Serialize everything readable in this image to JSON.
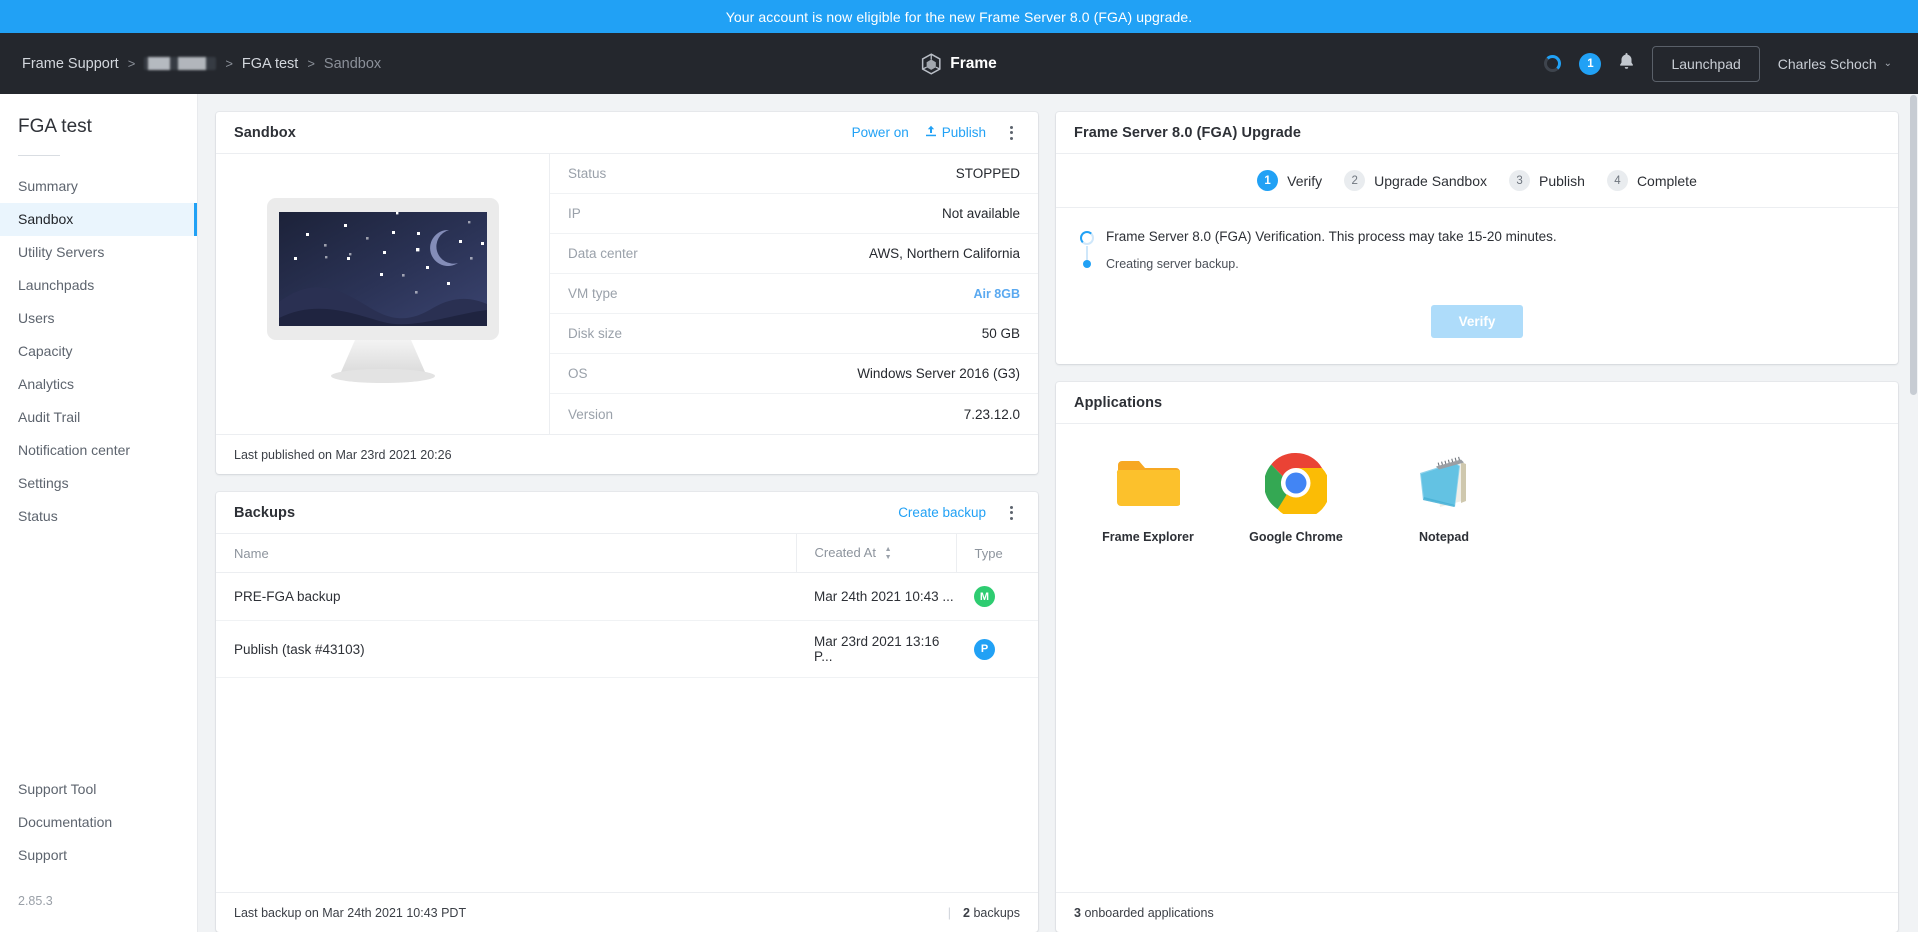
{
  "banner": {
    "message": "Your account is now eligible for the new Frame Server 8.0 (FGA) upgrade."
  },
  "header": {
    "brand": "Frame",
    "breadcrumb": [
      {
        "label": "Frame Support",
        "redacted": false,
        "current": false
      },
      {
        "label": "",
        "redacted": true,
        "current": false
      },
      {
        "label": "FGA test",
        "redacted": false,
        "current": false
      },
      {
        "label": "Sandbox",
        "redacted": false,
        "current": true
      }
    ],
    "separator": ">",
    "notification_count": "1",
    "launchpad_label": "Launchpad",
    "user_name": "Charles Schoch",
    "user_caret": "⌄"
  },
  "sidebar": {
    "title": "FGA test",
    "items": [
      {
        "label": "Summary",
        "active": false
      },
      {
        "label": "Sandbox",
        "active": true
      },
      {
        "label": "Utility Servers",
        "active": false
      },
      {
        "label": "Launchpads",
        "active": false
      },
      {
        "label": "Users",
        "active": false
      },
      {
        "label": "Capacity",
        "active": false
      },
      {
        "label": "Analytics",
        "active": false
      },
      {
        "label": "Audit Trail",
        "active": false
      },
      {
        "label": "Notification center",
        "active": false
      },
      {
        "label": "Settings",
        "active": false
      },
      {
        "label": "Status",
        "active": false
      }
    ],
    "bottom_items": [
      {
        "label": "Support Tool"
      },
      {
        "label": "Documentation"
      },
      {
        "label": "Support"
      }
    ],
    "version": "2.85.3"
  },
  "sandbox_card": {
    "title": "Sandbox",
    "power_on_label": "Power on",
    "publish_label": "Publish",
    "details": [
      {
        "label": "Status",
        "value": "STOPPED",
        "link": false
      },
      {
        "label": "IP",
        "value": "Not available",
        "link": false
      },
      {
        "label": "Data center",
        "value": "AWS, Northern California",
        "link": false
      },
      {
        "label": "VM type",
        "value": "Air 8GB",
        "link": true
      },
      {
        "label": "Disk size",
        "value": "50 GB",
        "link": false
      },
      {
        "label": "OS",
        "value": "Windows Server 2016 (G3)",
        "link": false
      },
      {
        "label": "Version",
        "value": "7.23.12.0",
        "link": false
      }
    ],
    "footer": "Last published on Mar 23rd 2021 20:26"
  },
  "backups_card": {
    "title": "Backups",
    "create_label": "Create backup",
    "columns": [
      "Name",
      "Created At",
      "Type",
      ""
    ],
    "rows": [
      {
        "name": "PRE-FGA backup",
        "created_at": "Mar 24th 2021 10:43 ...",
        "type_initial": "M",
        "type_color": "#2ecc71"
      },
      {
        "name": "Publish (task #43103)",
        "created_at": "Mar 23rd 2021 13:16 P...",
        "type_initial": "P",
        "type_color": "#21a1f5"
      }
    ],
    "footer_left": "Last backup on Mar 24th 2021 10:43 PDT",
    "footer_divider": "|",
    "footer_count_num": "2",
    "footer_count_label": "backups"
  },
  "upgrade_card": {
    "title": "Frame Server 8.0 (FGA) Upgrade",
    "steps": [
      {
        "num": "1",
        "label": "Verify",
        "active": true
      },
      {
        "num": "2",
        "label": "Upgrade Sandbox",
        "active": false
      },
      {
        "num": "3",
        "label": "Publish",
        "active": false
      },
      {
        "num": "4",
        "label": "Complete",
        "active": false
      }
    ],
    "progress_main": "Frame Server 8.0 (FGA) Verification. This process may take 15-20 minutes.",
    "progress_sub": "Creating server backup.",
    "verify_button": "Verify"
  },
  "applications_card": {
    "title": "Applications",
    "apps": [
      {
        "name": "Frame Explorer",
        "icon": "folder-icon"
      },
      {
        "name": "Google Chrome",
        "icon": "chrome-icon"
      },
      {
        "name": "Notepad",
        "icon": "notepad-icon"
      }
    ],
    "footer_count": "3",
    "footer_label": "onboarded applications"
  },
  "colors": {
    "accent": "#21a1f5",
    "header_bg": "#24272d",
    "page_bg": "#f1f3f5"
  }
}
